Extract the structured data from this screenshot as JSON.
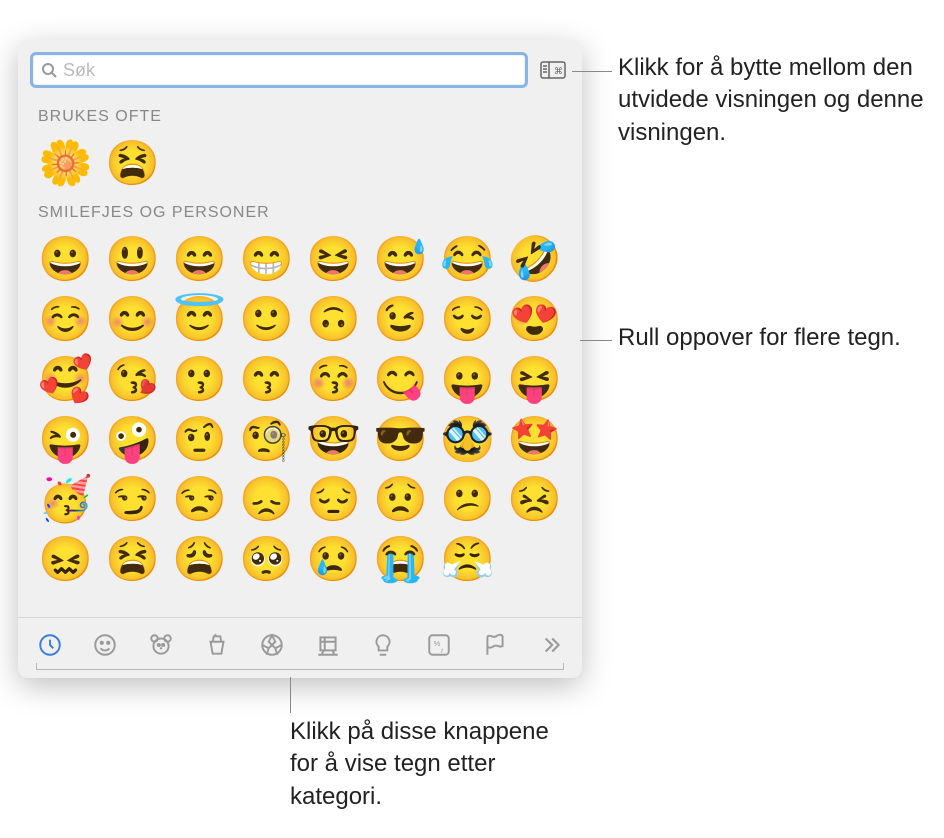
{
  "search": {
    "placeholder": "Søk",
    "value": ""
  },
  "sections": {
    "frequent": {
      "title": "BRUKES OFTE",
      "items": [
        "🌼",
        "😫"
      ]
    },
    "smileys": {
      "title": "SMILEFJES OG PERSONER",
      "items": [
        "😀",
        "😃",
        "😄",
        "😁",
        "😆",
        "😅",
        "😂",
        "🤣",
        "☺️",
        "😊",
        "😇",
        "🙂",
        "🙃",
        "😉",
        "😌",
        "😍",
        "🥰",
        "😘",
        "😗",
        "😙",
        "😚",
        "😋",
        "😛",
        "😝",
        "😜",
        "🤪",
        "🤨",
        "🧐",
        "🤓",
        "😎",
        "🥸",
        "🤩",
        "🥳",
        "😏",
        "😒",
        "😞",
        "😔",
        "😟",
        "😕",
        "😣",
        "😖",
        "😫",
        "😩",
        "🥺",
        "😢",
        "😭",
        "😤"
      ]
    }
  },
  "categories": [
    {
      "name": "frequently-used",
      "active": true
    },
    {
      "name": "smileys-people",
      "active": false
    },
    {
      "name": "animals-nature",
      "active": false
    },
    {
      "name": "food-drink",
      "active": false
    },
    {
      "name": "activity",
      "active": false
    },
    {
      "name": "travel-places",
      "active": false
    },
    {
      "name": "objects",
      "active": false
    },
    {
      "name": "symbols",
      "active": false
    },
    {
      "name": "flags",
      "active": false
    },
    {
      "name": "more",
      "active": false
    }
  ],
  "callouts": {
    "expand": "Klikk for å bytte mellom den utvidede visningen og denne visningen.",
    "scroll": "Rull oppover for flere tegn.",
    "categories": "Klikk på disse knappene for å vise tegn etter kategori."
  }
}
